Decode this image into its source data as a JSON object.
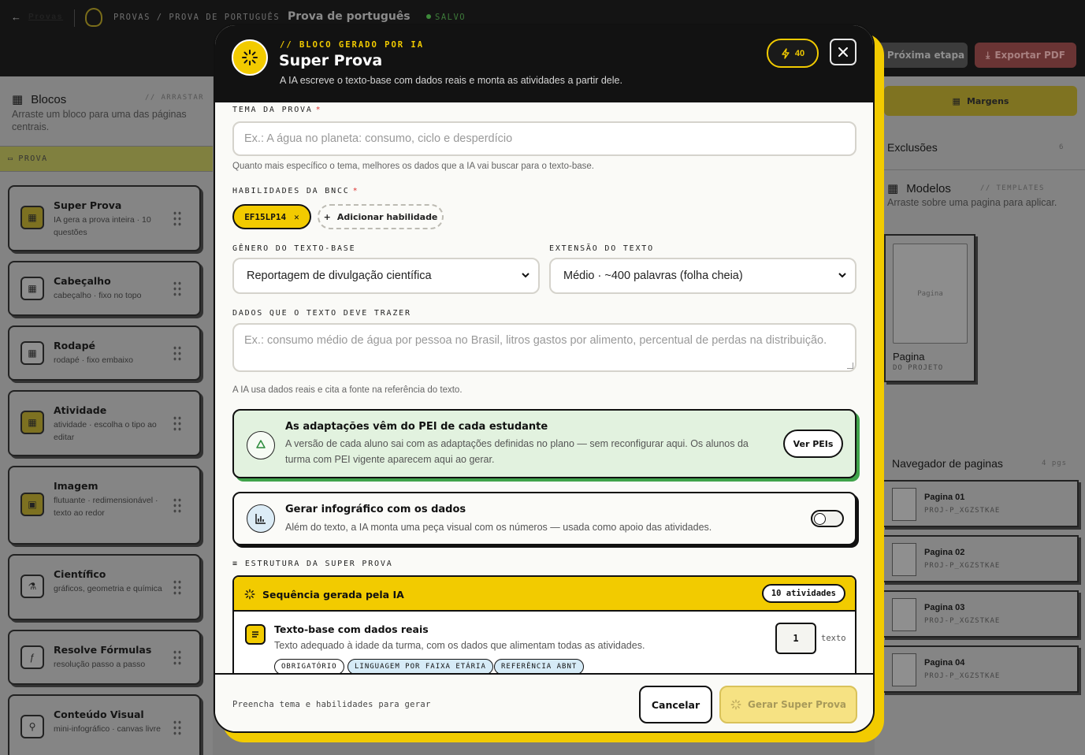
{
  "topbar": {
    "back_label": "Provas",
    "breadcrumb": "PROVAS / PROVA DE PORTUGUÊS",
    "doc_title": "Prova de português",
    "saved_label": "SALVO",
    "next_label": "Próxima etapa",
    "export_label": "Exportar PDF"
  },
  "left_panel": {
    "title": "Blocos",
    "drag_hint": "// ARRASTAR",
    "subtitle": "Arraste um bloco para uma das páginas centrais.",
    "section": "PROVA",
    "blocks": [
      {
        "title": "Super Prova",
        "desc": "IA gera a prova inteira · 10 questões",
        "icon": "grid-icon"
      },
      {
        "title": "Cabeçalho",
        "desc": "cabeçalho · fixo no topo",
        "icon": "layout-icon"
      },
      {
        "title": "Rodapé",
        "desc": "rodapé · fixo embaixo",
        "icon": "layout-icon"
      },
      {
        "title": "Atividade",
        "desc": "atividade · escolha o tipo ao editar",
        "icon": "grid-icon"
      },
      {
        "title": "Imagem",
        "desc": "flutuante · redimensionável · texto ao redor",
        "icon": "image-icon"
      },
      {
        "title": "Científico",
        "desc": "gráficos, geometria e química",
        "icon": "flask-icon"
      },
      {
        "title": "Resolve Fórmulas",
        "desc": "resolução passo a passo",
        "icon": "formula-icon"
      },
      {
        "title": "Conteúdo Visual",
        "desc": "mini-infográfico · canvas livre",
        "icon": "nodes-icon"
      }
    ]
  },
  "right_panel": {
    "margins_label": "Margens",
    "exclusions_title": "Exclusões",
    "exclusions_count": "6",
    "models_title": "Modelos",
    "models_tag": "// TEMPLATES",
    "models_sub": "Arraste sobre uma pagina para aplicar.",
    "template": {
      "thumb_label": "Pagina",
      "name": "Pagina",
      "source": "DO PROJETO"
    },
    "navigator_title": "Navegador de paginas",
    "navigator_count": "4 pgs",
    "pages": [
      {
        "name": "Pagina 01",
        "code": "PROJ-P_XGZSTKAE"
      },
      {
        "name": "Pagina 02",
        "code": "PROJ-P_XGZSTKAE"
      },
      {
        "name": "Pagina 03",
        "code": "PROJ-P_XGZSTKAE"
      },
      {
        "name": "Pagina 04",
        "code": "PROJ-P_XGZSTKAE"
      }
    ]
  },
  "modal": {
    "kicker": "// BLOCO GERADO POR IA",
    "title": "Super Prova",
    "subtitle": "A IA escreve o texto-base com dados reais e monta as atividades a partir dele.",
    "credits": "40",
    "theme": {
      "label": "TEMA DA PROVA",
      "required_mark": "*",
      "placeholder": "Ex.: A água no planeta: consumo, ciclo e desperdício",
      "hint": "Quanto mais específico o tema, melhores os dados que a IA vai buscar para o texto-base."
    },
    "skills": {
      "label": "HABILIDADES DA BNCC",
      "required_mark": "*",
      "selected": [
        "EF15LP14"
      ],
      "add_label": "Adicionar habilidade"
    },
    "genre": {
      "label": "GÊNERO DO TEXTO-BASE",
      "value": "Reportagem de divulgação científica"
    },
    "length": {
      "label": "EXTENSÃO DO TEXTO",
      "value": "Médio · ~400 palavras (folha cheia)"
    },
    "data_field": {
      "label": "DADOS QUE O TEXTO DEVE TRAZER",
      "placeholder": "Ex.: consumo médio de água por pessoa no Brasil, litros gastos por alimento, percentual de perdas na distribuição.",
      "hint": "A IA usa dados reais e cita a fonte na referência do texto."
    },
    "pei_card": {
      "title": "As adaptações vêm do PEI de cada estudante",
      "desc": "A versão de cada aluno sai com as adaptações definidas no plano — sem reconfigurar aqui. Os alunos da turma com PEI vigente aparecem aqui ao gerar.",
      "button": "Ver PEIs",
      "color": "#3fa34a"
    },
    "infographic_card": {
      "title": "Gerar infográfico com os dados",
      "desc": "Além do texto, a IA monta uma peça visual com os números — usada como apoio das atividades.",
      "toggle_on": false
    },
    "structure": {
      "label": "ESTRUTURA DA SUPER PROVA",
      "sequence_title": "Sequência gerada pela IA",
      "count_label": "10 atividades",
      "items": [
        {
          "title": "Texto-base com dados reais",
          "desc": "Texto adequado à idade da turma, com os dados que alimentam todas as atividades.",
          "tags": [
            "OBRIGATÓRIO",
            "LINGUAGEM POR FAIXA ETÁRIA",
            "REFERÊNCIA ABNT"
          ],
          "qty": "1",
          "unit": "texto"
        }
      ]
    },
    "footer": {
      "hint": "Preencha tema e habilidades para gerar",
      "cancel_label": "Cancelar",
      "generate_label": "Gerar Super Prova"
    },
    "accent_color": "#f2cb00"
  }
}
